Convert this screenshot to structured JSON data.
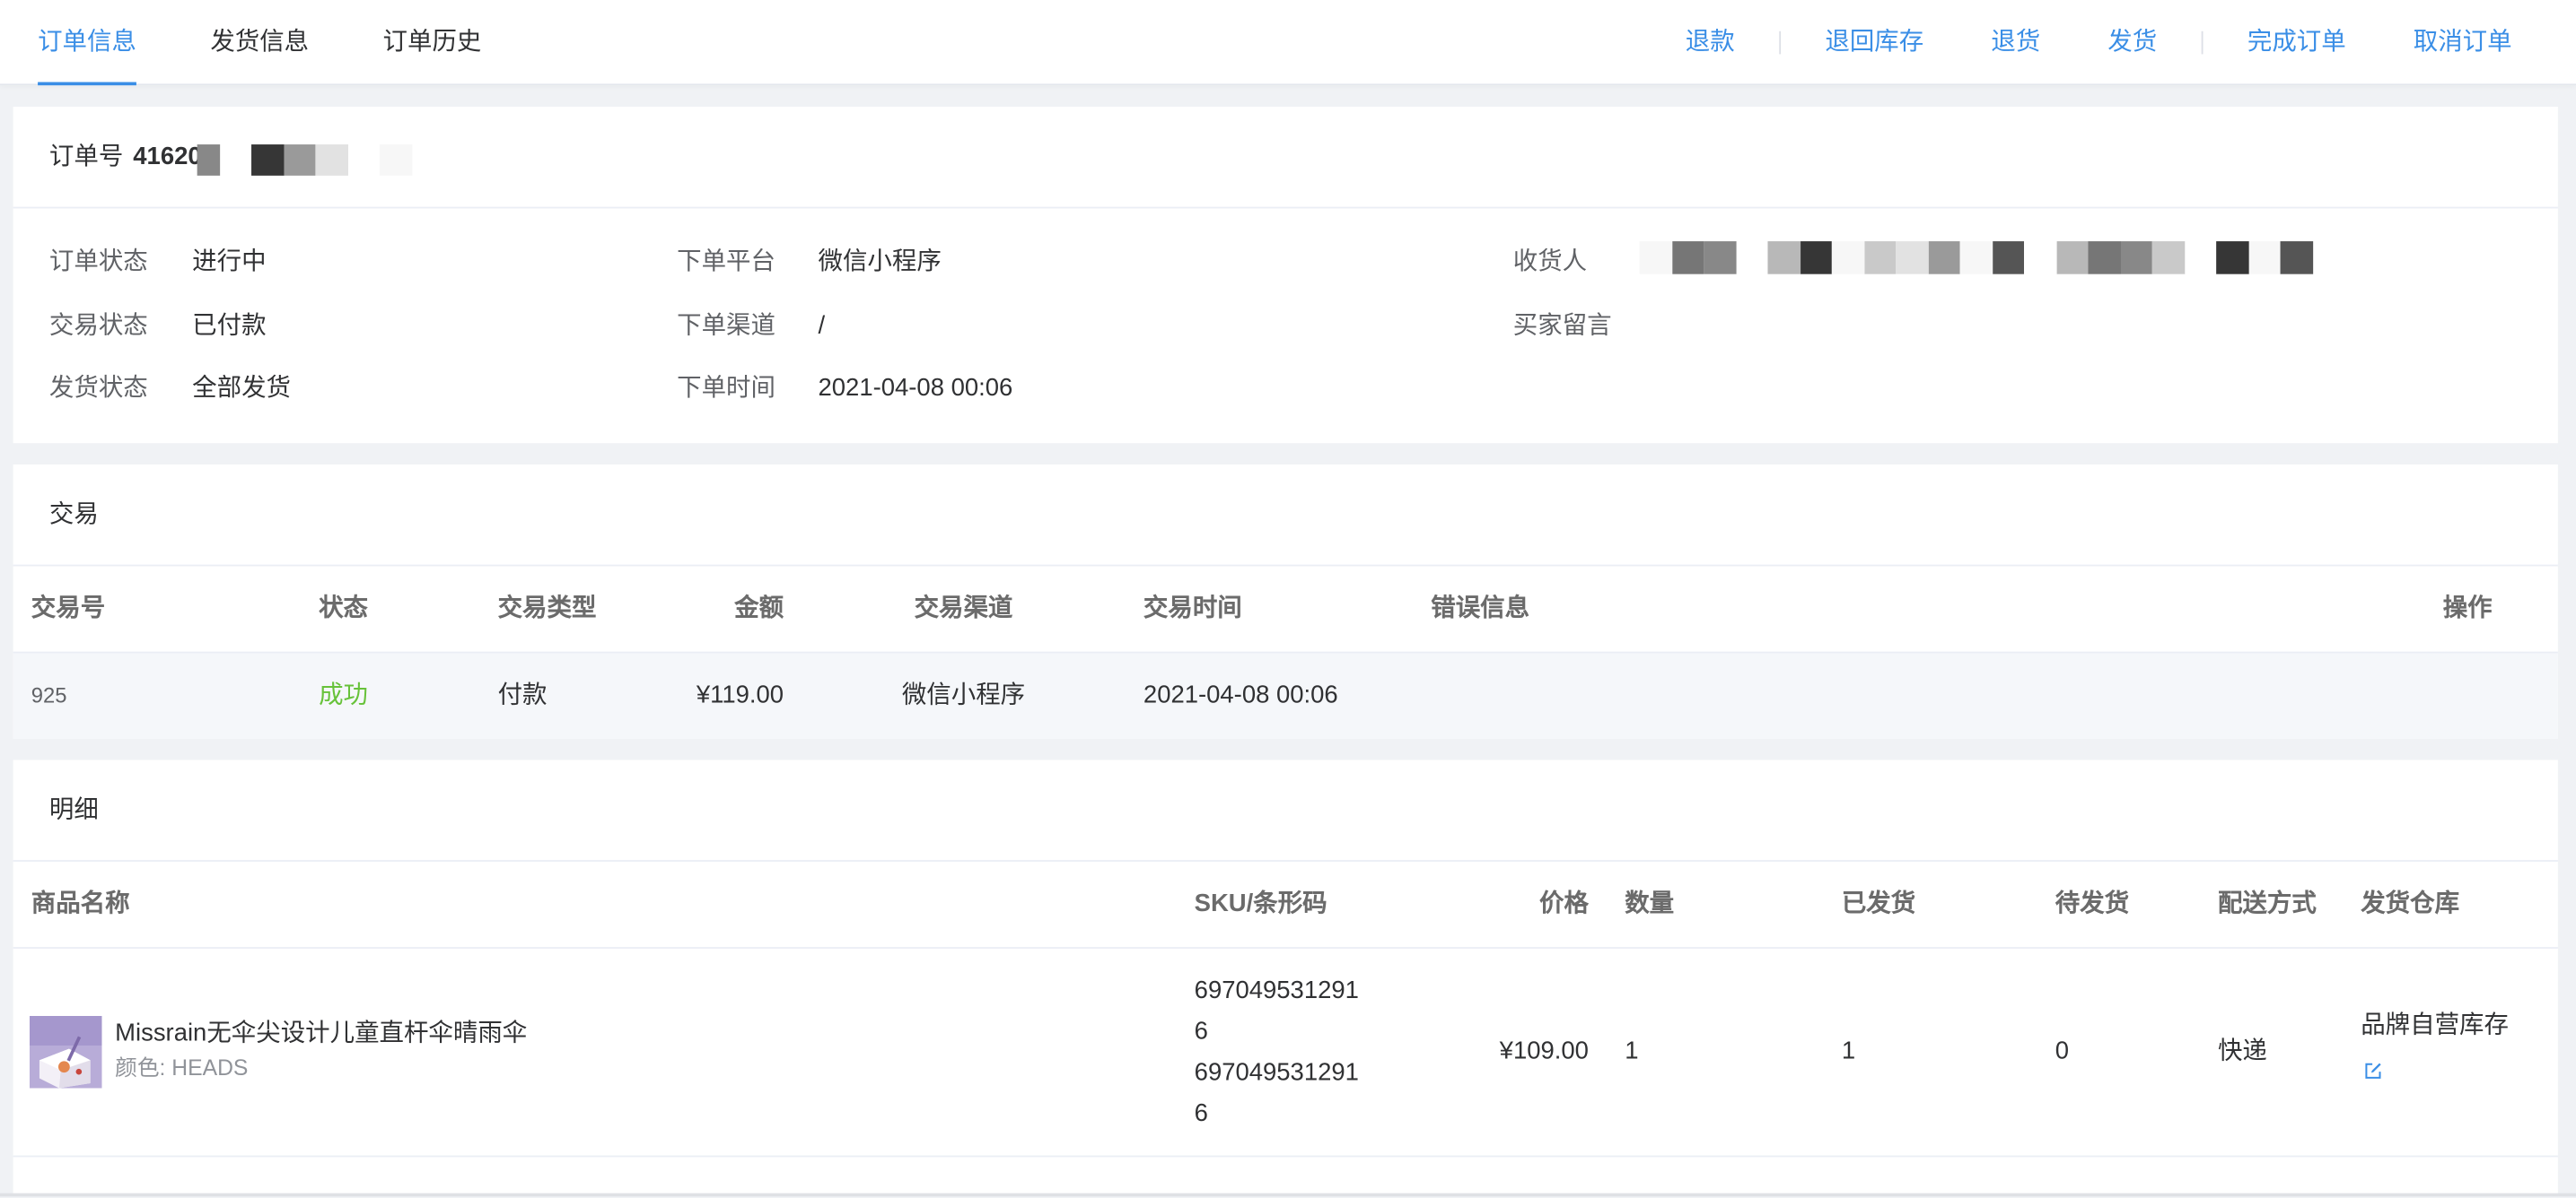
{
  "colors": {
    "accent": "#3a8ee6",
    "success": "#67c23a",
    "page_background": "#f0f2f5"
  },
  "tabs": [
    {
      "label": "订单信息"
    },
    {
      "label": "发货信息"
    },
    {
      "label": "订单历史"
    }
  ],
  "active_tab_index": 0,
  "actions": {
    "refund": "退款",
    "return_to_stock": "退回库存",
    "return_goods": "退货",
    "ship": "发货",
    "complete_order": "完成订单",
    "cancel_order": "取消订单"
  },
  "order": {
    "number_label": "订单号",
    "number": "41620",
    "fields": [
      {
        "label": "订单状态",
        "value": "进行中"
      },
      {
        "label": "交易状态",
        "value": "已付款"
      },
      {
        "label": "发货状态",
        "value": "全部发货"
      },
      {
        "label": "下单平台",
        "value": "微信小程序"
      },
      {
        "label": "下单渠道",
        "value": "/"
      },
      {
        "label": "下单时间",
        "value": "2021-04-08 00:06"
      }
    ],
    "receiver_label": "收货人",
    "buyer_message_label": "买家留言"
  },
  "transactions": {
    "title": "交易",
    "columns": [
      "交易号",
      "状态",
      "交易类型",
      "金额",
      "交易渠道",
      "交易时间",
      "错误信息",
      "操作"
    ],
    "rows": [
      {
        "id": "925",
        "status": "成功",
        "type": "付款",
        "amount": "¥119.00",
        "channel": "微信小程序",
        "time": "2021-04-08 00:06"
      }
    ]
  },
  "details": {
    "title": "明细",
    "columns": [
      "商品名称",
      "SKU/条形码",
      "价格",
      "数量",
      "已发货",
      "待发货",
      "配送方式",
      "发货仓库"
    ],
    "items": [
      {
        "name": "Missrain无伞尖设计儿童直杆伞晴雨伞",
        "spec": "颜色: HEADS",
        "sku": "6970495312916",
        "barcode": "6970495312916",
        "price": "¥109.00",
        "quantity": "1",
        "shipped": "1",
        "pending": "0",
        "delivery": "快递",
        "warehouse": "品牌自营库存"
      }
    ]
  },
  "icons": {
    "product_image": "umbrella-product-photo",
    "warehouse_edit": "edit-icon"
  }
}
